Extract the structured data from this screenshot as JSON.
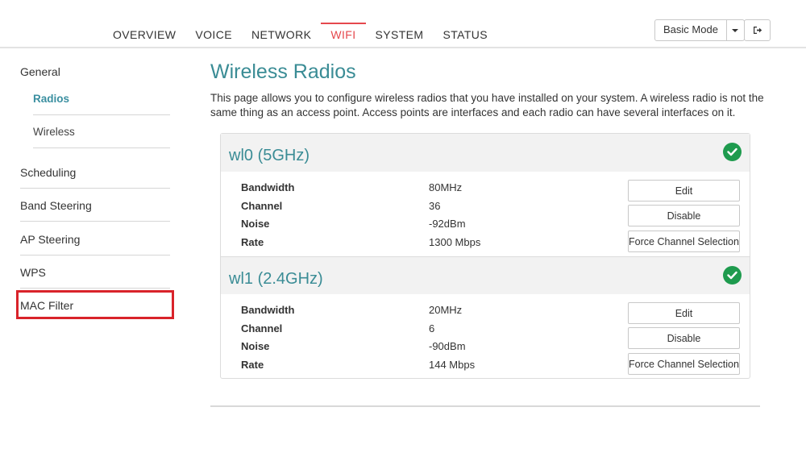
{
  "nav": {
    "items": [
      {
        "label": "OVERVIEW",
        "active": false
      },
      {
        "label": "VOICE",
        "active": false
      },
      {
        "label": "NETWORK",
        "active": false
      },
      {
        "label": "WIFI",
        "active": true
      },
      {
        "label": "SYSTEM",
        "active": false
      },
      {
        "label": "STATUS",
        "active": false
      }
    ],
    "mode_label": "Basic Mode",
    "logout_icon": "sign-out-icon"
  },
  "sidebar": {
    "general": "General",
    "radios": "Radios",
    "wireless": "Wireless",
    "scheduling": "Scheduling",
    "band_steering": "Band Steering",
    "ap_steering": "AP Steering",
    "wps": "WPS",
    "mac_filter": "MAC Filter"
  },
  "main": {
    "title": "Wireless Radios",
    "description": "This page allows you to configure wireless radios that you have installed on your system. A wireless radio is not the same thing as an access point. Access points are interfaces and each radio can have several interfaces on it."
  },
  "labels": {
    "bandwidth": "Bandwidth",
    "channel": "Channel",
    "noise": "Noise",
    "rate": "Rate",
    "edit": "Edit",
    "disable": "Disable",
    "force_channel": "Force Channel Selection"
  },
  "radios": [
    {
      "name": "wl0 (5GHz)",
      "bandwidth": "80MHz",
      "channel": "36",
      "noise": "-92dBm",
      "rate": "1300 Mbps"
    },
    {
      "name": "wl1 (2.4GHz)",
      "bandwidth": "20MHz",
      "channel": "6",
      "noise": "-90dBm",
      "rate": "144 Mbps"
    }
  ],
  "colors": {
    "accent": "#3a8c95",
    "active_tab": "#e5484d",
    "status_ok": "#1e9b4e",
    "highlight_box": "#d9232a"
  }
}
